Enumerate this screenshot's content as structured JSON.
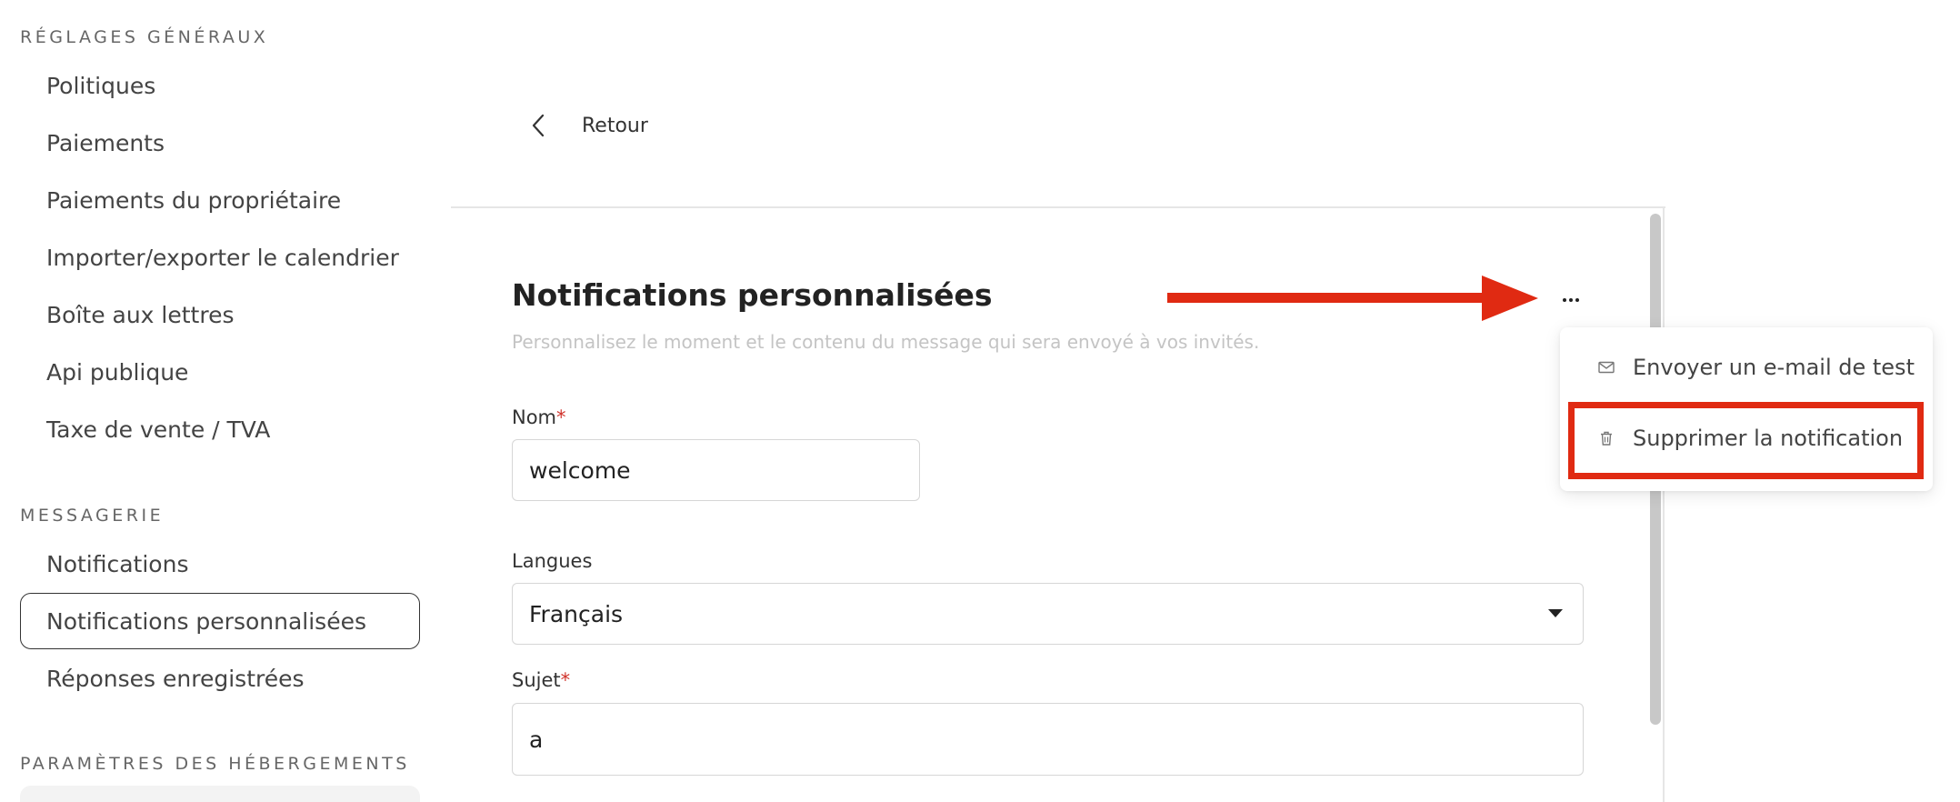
{
  "sidebar": {
    "sections": [
      {
        "title": "RÉGLAGES GÉNÉRAUX",
        "items": [
          {
            "label": "Politiques"
          },
          {
            "label": "Paiements"
          },
          {
            "label": "Paiements du propriétaire"
          },
          {
            "label": "Importer/exporter le calendrier"
          },
          {
            "label": "Boîte aux lettres"
          },
          {
            "label": "Api publique"
          },
          {
            "label": "Taxe de vente / TVA"
          }
        ]
      },
      {
        "title": "MESSAGERIE",
        "items": [
          {
            "label": "Notifications"
          },
          {
            "label": "Notifications personnalisées",
            "active": true
          },
          {
            "label": "Réponses enregistrées"
          }
        ]
      },
      {
        "title": "PARAMÈTRES DES HÉBERGEMENTS",
        "items": []
      }
    ]
  },
  "back": {
    "label": "Retour",
    "icon": "chevron-left-icon"
  },
  "form": {
    "title": "Notifications personnalisées",
    "description": "Personnalisez le moment et le contenu du message qui sera envoyé à vos invités.",
    "more_icon": "more-horizontal-icon",
    "fields": {
      "name": {
        "label": "Nom",
        "required_mark": "*",
        "value": "welcome"
      },
      "language": {
        "label": "Langues",
        "value": "Français"
      },
      "subject": {
        "label": "Sujet",
        "required_mark": "*",
        "value": "a"
      }
    }
  },
  "menu": {
    "items": [
      {
        "label": "Envoyer un e-mail de test",
        "icon": "mail-icon"
      },
      {
        "label": "Supprimer la notification",
        "icon": "trash-icon",
        "highlighted": true
      }
    ]
  },
  "colors": {
    "annotation_red": "#e02a12",
    "required_red": "#d0322b",
    "muted_text": "#c4c4c4"
  }
}
